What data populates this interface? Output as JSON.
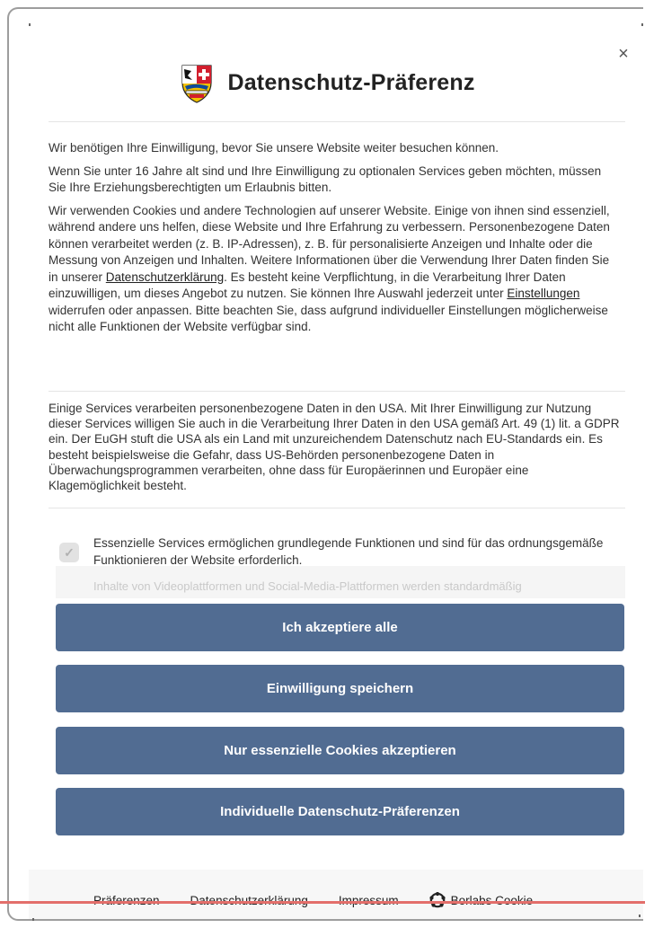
{
  "dialog": {
    "title": "Datenschutz-Präferenz",
    "close_label": "×",
    "intro_lines": [
      "Wir benötigen Ihre Einwilligung, bevor Sie unsere Website weiter besuchen können.",
      "Wenn Sie unter 16 Jahre alt sind und Ihre Einwilligung zu optionalen Services geben möchten, müssen Sie Ihre Erziehungsberechtigten um Erlaubnis bitten."
    ],
    "cookie_text": {
      "part1": "Wir verwenden Cookies und andere Technologien auf unserer Website. Einige von ihnen sind essenziell, während andere uns helfen, diese Website und Ihre Erfahrung zu verbessern. Personenbezogene Daten können verarbeitet werden (z. B. IP-Adressen), z. B. für personalisierte Anzeigen und Inhalte oder die Messung von Anzeigen und Inhalten. Weitere Informationen über die Verwendung Ihrer Daten finden Sie in unserer ",
      "link1": "Datenschutzerklärung",
      "part2": ". Es besteht keine Verpflichtung, in die Verarbeitung Ihrer Daten einzuwilligen, um dieses Angebot zu nutzen. Sie können Ihre Auswahl jederzeit unter ",
      "link2": "Einstellungen",
      "part3": " widerrufen oder anpassen. Bitte beachten Sie, dass aufgrund individueller Einstellungen möglicherweise nicht alle Funktionen der Website verfügbar sind."
    },
    "usa_text": "Einige Services verarbeiten personenbezogene Daten in den USA. Mit Ihrer Einwilligung zur Nutzung dieser Services willigen Sie auch in die Verarbeitung Ihrer Daten in den USA gemäß Art. 49 (1) lit. a GDPR ein. Der EuGH stuft die USA als ein Land mit unzureichendem Datenschutz nach EU-Standards ein. Es besteht beispielsweise die Gefahr, dass US-Behörden personenbezogene Daten in Überwachungsprogrammen verarbeiten, ohne dass für Europäerinnen und Europäer eine Klagemöglichkeit besteht.",
    "essential_text": "Essenzielle Services ermöglichen grundlegende Funktionen und sind für das ordnungsgemäße Funktionieren der Website erforderlich.",
    "faded_text": "Inhalte von Videoplattformen und Social-Media-Plattformen werden standardmäßig",
    "buttons": {
      "accept_all": "Ich akzeptiere alle",
      "save": "Einwilligung speichern",
      "essential_only": "Nur essenzielle Cookies akzeptieren",
      "individual": "Individuelle Datenschutz-Präferenzen"
    },
    "footer": {
      "preferences": "Präferenzen",
      "privacy": "Datenschutzerklärung",
      "imprint": "Impressum",
      "brand": "Borlabs Cookie"
    }
  },
  "icons": {
    "close": "close-icon",
    "checkbox": "check-icon",
    "logo": "coat-of-arms-logo",
    "brand": "borlabs-cookie-icon"
  },
  "colors": {
    "button": "#516c92",
    "footer_bg": "#f7f7f7",
    "accent_line": "#e36f6b"
  }
}
